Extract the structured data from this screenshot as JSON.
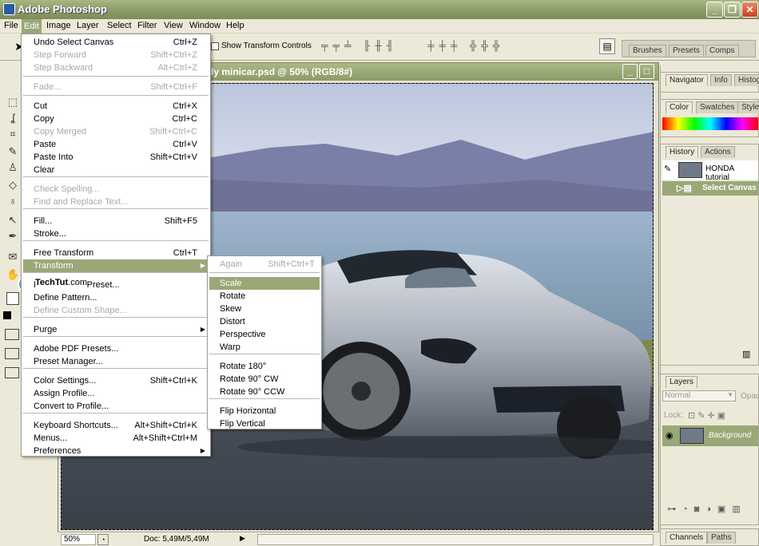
{
  "app": {
    "title": "Adobe Photoshop"
  },
  "menubar": [
    "File",
    "Edit",
    "Image",
    "Layer",
    "Select",
    "Filter",
    "View",
    "Window",
    "Help"
  ],
  "options": {
    "show_transform": "Show Transform Controls"
  },
  "palette_well": {
    "tabs": [
      "Brushes",
      "Presets",
      "Comps"
    ]
  },
  "document": {
    "title": "dy minicar.psd @ 50% (RGB/8#)",
    "zoom": "50%",
    "doc_info": "Doc: 5,49M/5,49M"
  },
  "edit_menu": {
    "items": [
      {
        "label": "Undo Select Canvas",
        "shortcut": "Ctrl+Z"
      },
      {
        "label": "Step Forward",
        "shortcut": "Shift+Ctrl+Z",
        "disabled": true
      },
      {
        "label": "Step Backward",
        "shortcut": "Alt+Ctrl+Z",
        "disabled": true
      },
      {
        "label": "Fade...",
        "shortcut": "Shift+Ctrl+F",
        "disabled": true
      },
      {
        "label": "Cut",
        "shortcut": "Ctrl+X"
      },
      {
        "label": "Copy",
        "shortcut": "Ctrl+C"
      },
      {
        "label": "Copy Merged",
        "shortcut": "Shift+Ctrl+C",
        "disabled": true
      },
      {
        "label": "Paste",
        "shortcut": "Ctrl+V"
      },
      {
        "label": "Paste Into",
        "shortcut": "Shift+Ctrl+V"
      },
      {
        "label": "Clear",
        "shortcut": ""
      },
      {
        "label": "Check Spelling...",
        "shortcut": "",
        "disabled": true
      },
      {
        "label": "Find and Replace Text...",
        "shortcut": "",
        "disabled": true
      },
      {
        "label": "Fill...",
        "shortcut": "Shift+F5"
      },
      {
        "label": "Stroke...",
        "shortcut": ""
      },
      {
        "label": "Free Transform",
        "shortcut": "Ctrl+T"
      },
      {
        "label": "Transform",
        "shortcut": "",
        "submenu": true,
        "selected": true
      },
      {
        "label": "Define Brush Preset...",
        "shortcut": ""
      },
      {
        "label": "Define Pattern...",
        "shortcut": ""
      },
      {
        "label": "Define Custom Shape...",
        "shortcut": "",
        "disabled": true
      },
      {
        "label": "Purge",
        "shortcut": "",
        "submenu": true
      },
      {
        "label": "Adobe PDF Presets...",
        "shortcut": ""
      },
      {
        "label": "Preset Manager...",
        "shortcut": ""
      },
      {
        "label": "Color Settings...",
        "shortcut": "Shift+Ctrl+K"
      },
      {
        "label": "Assign Profile...",
        "shortcut": ""
      },
      {
        "label": "Convert to Profile...",
        "shortcut": ""
      },
      {
        "label": "Keyboard Shortcuts...",
        "shortcut": "Alt+Shift+Ctrl+K"
      },
      {
        "label": "Menus...",
        "shortcut": "Alt+Shift+Ctrl+M"
      },
      {
        "label": "Preferences",
        "shortcut": "",
        "submenu": true
      }
    ]
  },
  "transform_menu": {
    "items": [
      {
        "label": "Again",
        "shortcut": "Shift+Ctrl+T",
        "disabled": true
      },
      {
        "label": "Scale",
        "selected": true
      },
      {
        "label": "Rotate"
      },
      {
        "label": "Skew"
      },
      {
        "label": "Distort"
      },
      {
        "label": "Perspective"
      },
      {
        "label": "Warp"
      },
      {
        "label": "Rotate 180°"
      },
      {
        "label": "Rotate 90° CW"
      },
      {
        "label": "Rotate 90° CCW"
      },
      {
        "label": "Flip Horizontal"
      },
      {
        "label": "Flip Vertical"
      }
    ]
  },
  "watermark": {
    "brand_bold": "TechTut",
    "brand_rest": ".com"
  },
  "panels": {
    "nav_tabs": [
      "Navigator",
      "Info",
      "Histog"
    ],
    "color_tabs": [
      "Color",
      "Swatches",
      "Styles"
    ],
    "history_tabs": [
      "History",
      "Actions"
    ],
    "history_items": [
      "HONDA tutorial",
      "Select Canvas"
    ],
    "layers_tab": "Layers",
    "blend_mode": "Normal",
    "opacity_label": "Opac",
    "lock_label": "Lock:",
    "layer_name": "Background",
    "bottom_tabs": [
      "Channels",
      "Paths"
    ]
  },
  "colors": {
    "accent": "#9aa878",
    "titlebar": "#8c9b68"
  }
}
